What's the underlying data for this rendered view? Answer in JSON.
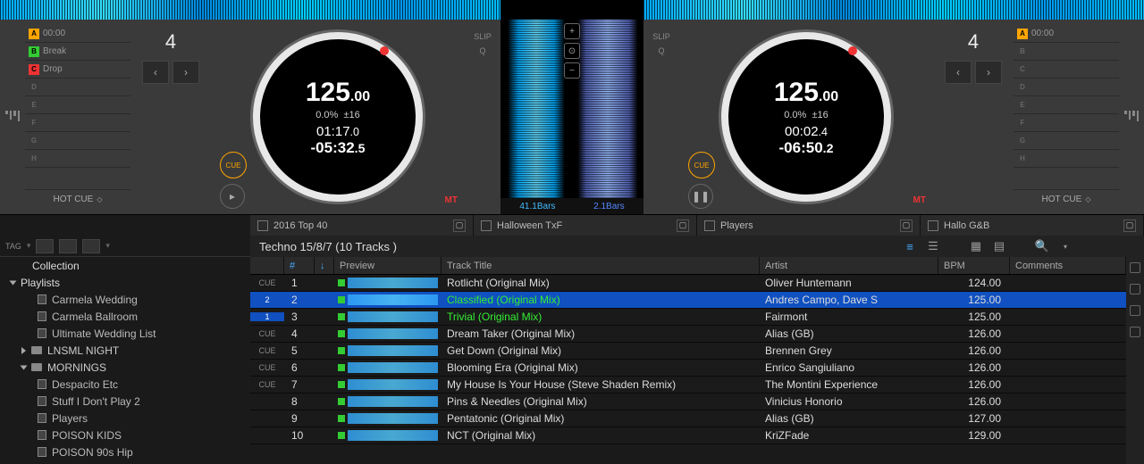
{
  "deckA": {
    "hotcues": [
      {
        "badge": "A",
        "color": "hc-a",
        "label": "00:00"
      },
      {
        "badge": "B",
        "color": "hc-b",
        "label": "Break"
      },
      {
        "badge": "C",
        "color": "hc-c",
        "label": "Drop"
      },
      {
        "badge": "D",
        "color": "",
        "label": ""
      },
      {
        "badge": "E",
        "color": "",
        "label": ""
      },
      {
        "badge": "F",
        "color": "",
        "label": ""
      },
      {
        "badge": "G",
        "color": "",
        "label": ""
      },
      {
        "badge": "H",
        "color": "",
        "label": ""
      }
    ],
    "hotcue_label": "HOT CUE",
    "beat": "4",
    "bpm_int": "125",
    "bpm_dec": ".00",
    "pitch": "0.0%",
    "range": "±16",
    "elapsed": "01:17",
    "elapsed_dec": ".0",
    "remain": "-05:32",
    "remain_dec": ".5",
    "cue": "CUE",
    "mt": "MT",
    "slip": "SLIP",
    "q": "Q"
  },
  "deckB": {
    "hotcues": [
      {
        "badge": "A",
        "color": "hc-a",
        "label": "00:00"
      },
      {
        "badge": "B",
        "color": "",
        "label": ""
      },
      {
        "badge": "C",
        "color": "",
        "label": ""
      },
      {
        "badge": "D",
        "color": "",
        "label": ""
      },
      {
        "badge": "E",
        "color": "",
        "label": ""
      },
      {
        "badge": "F",
        "color": "",
        "label": ""
      },
      {
        "badge": "G",
        "color": "",
        "label": ""
      },
      {
        "badge": "H",
        "color": "",
        "label": ""
      }
    ],
    "hotcue_label": "HOT CUE",
    "beat": "4",
    "bpm_int": "125",
    "bpm_dec": ".00",
    "pitch": "0.0%",
    "range": "±16",
    "elapsed": "00:02",
    "elapsed_dec": ".4",
    "remain": "-06:50",
    "remain_dec": ".2",
    "cue": "CUE",
    "mt": "MT",
    "slip": "SLIP",
    "q": "Q"
  },
  "center": {
    "bars_left": "41.1Bars",
    "bars_right": "2.1Bars"
  },
  "tabs": [
    "2016 Top 40",
    "Halloween TxF",
    "Players",
    "Hallo G&B"
  ],
  "playlist": {
    "title": "Techno 15/8/7 (10 Tracks )",
    "headers": {
      "num": "#",
      "preview": "Preview",
      "title": "Track Title",
      "artist": "Artist",
      "bpm": "BPM",
      "comments": "Comments"
    },
    "tracks": [
      {
        "cue": "CUE",
        "n": "1",
        "title": "Rotlicht (Original Mix)",
        "artist": "Oliver Huntemann",
        "bpm": "124.00"
      },
      {
        "cue": "2",
        "badge": true,
        "n": "2",
        "title": "Classified (Original Mix)",
        "artist": "Andres Campo, Dave S",
        "bpm": "125.00",
        "sel": true,
        "green": true
      },
      {
        "cue": "1",
        "badge": true,
        "n": "3",
        "title": "Trivial (Original Mix)",
        "artist": "Fairmont",
        "bpm": "125.00",
        "green": true
      },
      {
        "cue": "CUE",
        "n": "4",
        "title": "Dream Taker (Original Mix)",
        "artist": "Alias (GB)",
        "bpm": "126.00"
      },
      {
        "cue": "CUE",
        "n": "5",
        "title": "Get Down (Original Mix)",
        "artist": "Brennen Grey",
        "bpm": "126.00"
      },
      {
        "cue": "CUE",
        "n": "6",
        "title": "Blooming Era (Original Mix)",
        "artist": "Enrico Sangiuliano",
        "bpm": "126.00"
      },
      {
        "cue": "CUE",
        "n": "7",
        "title": "My House Is Your House (Steve Shaden Remix)",
        "artist": "The Montini Experience",
        "bpm": "126.00"
      },
      {
        "cue": "",
        "n": "8",
        "title": "Pins & Needles (Original Mix)",
        "artist": "Vinicius Honorio",
        "bpm": "126.00"
      },
      {
        "cue": "",
        "n": "9",
        "title": "Pentatonic (Original Mix)",
        "artist": "Alias (GB)",
        "bpm": "127.00"
      },
      {
        "cue": "",
        "n": "10",
        "title": "NCT (Original Mix)",
        "artist": "KriZFade",
        "bpm": "129.00"
      }
    ]
  },
  "sidebar": {
    "collection": "Collection",
    "playlists": "Playlists",
    "items": [
      {
        "type": "sub",
        "label": "Carmela Wedding"
      },
      {
        "type": "sub",
        "label": "Carmela Ballroom"
      },
      {
        "type": "sub",
        "label": "Ultimate Wedding List"
      },
      {
        "type": "folder",
        "label": "LNSML NIGHT",
        "open": false
      },
      {
        "type": "folder",
        "label": "MORNINGS",
        "open": true
      },
      {
        "type": "sub",
        "label": "Despacito Etc"
      },
      {
        "type": "sub",
        "label": "Stuff I Don't Play 2"
      },
      {
        "type": "sub",
        "label": "Players"
      },
      {
        "type": "sub",
        "label": "POISON KIDS"
      },
      {
        "type": "sub",
        "label": "POISON 90s Hip"
      }
    ],
    "tag": "TAG"
  }
}
